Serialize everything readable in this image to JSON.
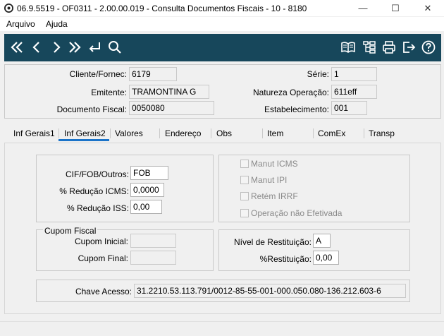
{
  "window": {
    "title": "06.9.5519 - OF0311 - 2.00.00.019 - Consulta Documentos Fiscais - 10 - 8180",
    "minimize_glyph": "—",
    "maximize_glyph": "☐",
    "close_glyph": "✕"
  },
  "menu": {
    "items": [
      "Arquivo",
      "Ajuda"
    ]
  },
  "toolbar": {
    "left_icons": [
      "first-icon",
      "previous-icon",
      "next-icon",
      "last-icon",
      "enter-icon",
      "search-icon"
    ],
    "right_icons": [
      "book-icon",
      "hierarchy-icon",
      "print-icon",
      "exit-icon",
      "help-icon"
    ],
    "background": "#17475b"
  },
  "header": {
    "cliente_label": "Cliente/Fornec:",
    "cliente_value": "6179",
    "emitente_label": "Emitente:",
    "emitente_value": "TRAMONTINA G",
    "documento_label": "Documento Fiscal:",
    "documento_value": "0050080",
    "serie_label": "Série:",
    "serie_value": "1",
    "natureza_label": "Natureza Operação:",
    "natureza_value": "611eff",
    "estabelecimento_label": "Estabelecimento:",
    "estabelecimento_value": "001"
  },
  "tabs": [
    {
      "label": "Inf Gerais1"
    },
    {
      "label": "Inf Gerais2",
      "active": true
    },
    {
      "label": "Valores"
    },
    {
      "label": "Endereço"
    },
    {
      "label": "Obs"
    },
    {
      "label": "Item"
    },
    {
      "label": "ComEx"
    },
    {
      "label": "Transp"
    }
  ],
  "inf_gerais2": {
    "cif_label": "CIF/FOB/Outros:",
    "cif_value": "FOB",
    "reducao_icms_label": "% Redução ICMS:",
    "reducao_icms_value": "0,0000",
    "reducao_iss_label": "% Redução ISS:",
    "reducao_iss_value": "0,00",
    "checks": [
      "Manut ICMS",
      "Manut IPI",
      "Retém IRRF",
      "Operação não Efetivada"
    ],
    "cupom_title": "Cupom Fiscal",
    "cupom_inicial_label": "Cupom Inicial:",
    "cupom_inicial_value": "",
    "cupom_final_label": "Cupom Final:",
    "cupom_final_value": "",
    "nivel_label": "Nível de Restituição:",
    "nivel_value": "A",
    "restituicao_label": "%Restituição:",
    "restituicao_value": "0,00",
    "chave_label": "Chave Acesso:",
    "chave_value": "31.2210.53.113.791/0012-85-55-001-000.050.080-136.212.603-6"
  },
  "colors": {
    "tab_accent": "#1a73c9"
  }
}
